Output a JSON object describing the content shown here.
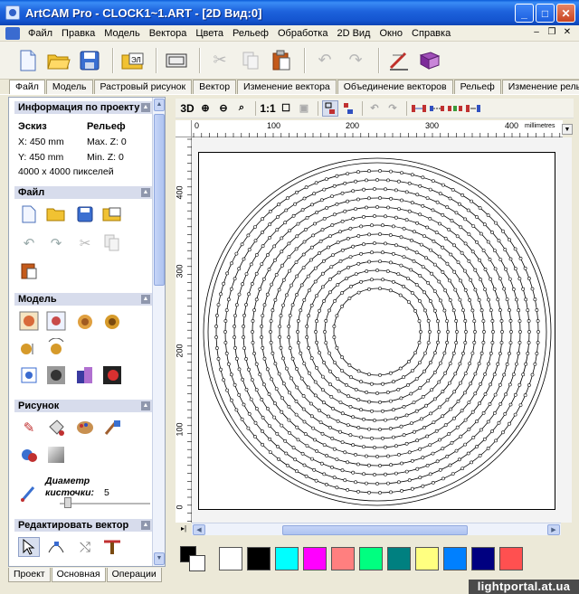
{
  "window": {
    "title": "ArtCAM Pro - CLOCK1~1.ART - [2D Вид:0]"
  },
  "menu": [
    "Файл",
    "Правка",
    "Модель",
    "Вектора",
    "Цвета",
    "Рельеф",
    "Обработка",
    "2D Вид",
    "Окно",
    "Справка"
  ],
  "toolbar": {
    "icons": [
      "new-file-icon",
      "open-folder-icon",
      "save-icon",
      "import-image-icon",
      "frame-icon",
      "cut-icon",
      "copy-icon",
      "paste-icon",
      "undo-icon",
      "redo-icon",
      "vector-edit-icon",
      "help-book-icon"
    ]
  },
  "top_tabs": [
    "Файл",
    "Модель",
    "Растровый рисунок",
    "Вектор",
    "Изменение вектора",
    "Объединение векторов",
    "Рельеф",
    "Изменение рельефа"
  ],
  "left_panel": {
    "project_info": {
      "header": "Информация по проекту",
      "sketch_label": "Эскиз",
      "relief_label": "Рельеф",
      "x_size": "X: 450 mm",
      "y_size": "Y: 450 mm",
      "max_z": "Max. Z: 0",
      "min_z": "Min. Z: 0",
      "pixels": "4000 x 4000 пикселей"
    },
    "file_section": "Файл",
    "model_section": "Модель",
    "drawing_section": "Рисунок",
    "brush_label_1": "Диаметр",
    "brush_label_2": "кисточки:",
    "brush_value": "5",
    "brush_level": 0.05,
    "edit_vector_section": "Редактировать вектор"
  },
  "bottom_tabs": [
    "Проект",
    "Основная",
    "Операции"
  ],
  "view_toolbar": {
    "mode_3d": "3D",
    "ratio": "1:1"
  },
  "ruler": {
    "top_labels": [
      "0",
      "100",
      "200",
      "300",
      "400"
    ],
    "unit": "millimetres",
    "left_labels": [
      "400",
      "300",
      "200",
      "100",
      "0"
    ]
  },
  "palette": {
    "colors": [
      "#ffffff",
      "#000000",
      "#00ffff",
      "#ff00ff",
      "#ff7f7f",
      "#00ff80",
      "#008080",
      "#ffff80",
      "#0080ff",
      "#000080",
      "#ff5050"
    ]
  },
  "watermark": "lightportal.at.ua"
}
